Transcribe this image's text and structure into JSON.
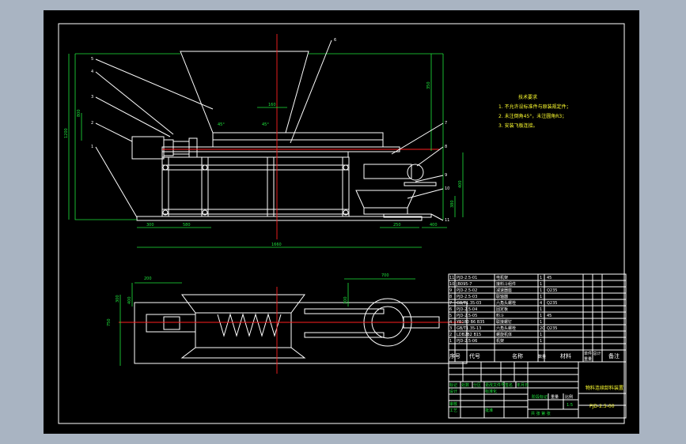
{
  "callouts": [
    "5",
    "4",
    "3",
    "2",
    "1",
    "6",
    "7",
    "8",
    "9",
    "10",
    "11"
  ],
  "front_dimensions": {
    "overall_width": "1660",
    "left_base": "300",
    "left_frame": "580",
    "right_base": "250",
    "right_small": "400",
    "hopper_top": "160",
    "overall_height": "1200",
    "left_small_a": "800",
    "left_small_b": "350",
    "right_h1": "400",
    "right_h2": "380",
    "angle_a": "45°",
    "angle_b": "45°"
  },
  "plan_dimensions": {
    "left_offset": "200",
    "right_span": "700",
    "left_h1": "300",
    "left_h2": "400",
    "right_h1": "300",
    "right_h2": "300",
    "overall": "750"
  },
  "tech_requirements": {
    "title": "技术要求",
    "items": [
      "1. 不允许设标准件与原装规定件；",
      "2. 未注倒角45°，未注圆角R3；",
      "3. 安装飞板连接。"
    ]
  },
  "bom": {
    "rows": [
      {
        "no": "11",
        "code": "PJD-2.5-01",
        "name": "电机架",
        "qty": "1",
        "mat": "45",
        "note": ""
      },
      {
        "no": "10",
        "code": "JB095-7",
        "name": "接料斗组件",
        "qty": "1",
        "mat": "",
        "note": ""
      },
      {
        "no": "9",
        "code": "PJD-2.5-02",
        "name": "减速器座",
        "qty": "1",
        "mat": "Q235",
        "note": ""
      },
      {
        "no": "8",
        "code": "PJD-2.5-03",
        "name": "联轴器",
        "qty": "1",
        "mat": "",
        "note": ""
      },
      {
        "no": "7",
        "code": "GB/T1.35-03",
        "name": "六角头螺栓",
        "qty": "4",
        "mat": "Q235",
        "note": ""
      },
      {
        "no": "6",
        "code": "PJD-2.5-04",
        "name": "固定板",
        "qty": "1",
        "mat": "",
        "note": ""
      },
      {
        "no": "5",
        "code": "PJD-2.5-05",
        "name": "料斗",
        "qty": "1",
        "mat": "45",
        "note": ""
      },
      {
        "no": "4",
        "code": "YB180 B6 B35",
        "name": "联接螺钉",
        "qty": "1",
        "mat": "",
        "note": ""
      },
      {
        "no": "3",
        "code": "GB/T1.35-13",
        "name": "六角头螺栓",
        "qty": "20",
        "mat": "Q235",
        "note": ""
      },
      {
        "no": "2",
        "code": "LDB2B2 B15",
        "name": "螺旋机体",
        "qty": "1",
        "mat": "",
        "note": ""
      },
      {
        "no": "1",
        "code": "PJD-2.5-06",
        "name": "机架",
        "qty": "1",
        "mat": "",
        "note": ""
      }
    ],
    "header": {
      "no": "序号",
      "code": "代号",
      "name": "名称",
      "qty": "数量",
      "mat": "材料",
      "weight": "单件 总计",
      "weight_sub": "重量",
      "note": "备注"
    }
  },
  "title_block": {
    "drawing_title": "物料连续卸料装置",
    "drawing_no": "PJD-2.5-00",
    "scale_label": "比例",
    "scale": "1:5",
    "stage_label": "阶段标记",
    "weight_label": "重量",
    "sheet_label": "共 张 第 张",
    "row_labels": [
      "标记",
      "处数",
      "分区",
      "更改文件号",
      "签名",
      "年月日"
    ],
    "role_labels": [
      "设计",
      "审核",
      "工艺",
      "标准化",
      "批准"
    ]
  }
}
